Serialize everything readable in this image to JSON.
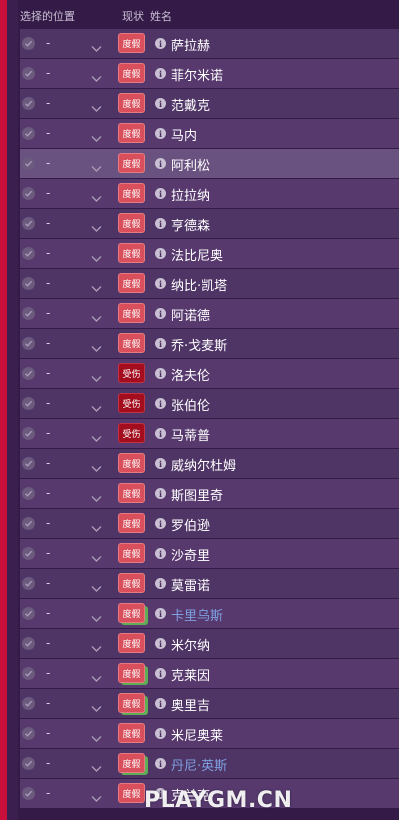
{
  "header": {
    "position_col": "选择的位置",
    "status_col": "现状",
    "name_col": "姓名"
  },
  "players": [
    {
      "position": "-",
      "status": "度假",
      "name": "萨拉赫"
    },
    {
      "position": "-",
      "status": "度假",
      "name": "菲尔米诺"
    },
    {
      "position": "-",
      "status": "度假",
      "name": "范戴克"
    },
    {
      "position": "-",
      "status": "度假",
      "name": "马内"
    },
    {
      "position": "-",
      "status": "度假",
      "name": "阿利松"
    },
    {
      "position": "-",
      "status": "度假",
      "name": "拉拉纳"
    },
    {
      "position": "-",
      "status": "度假",
      "name": "亨德森"
    },
    {
      "position": "-",
      "status": "度假",
      "name": "法比尼奥"
    },
    {
      "position": "-",
      "status": "度假",
      "name": "纳比·凯塔"
    },
    {
      "position": "-",
      "status": "度假",
      "name": "阿诺德"
    },
    {
      "position": "-",
      "status": "度假",
      "name": "乔·戈麦斯"
    },
    {
      "position": "-",
      "status": "受伤",
      "name": "洛夫伦"
    },
    {
      "position": "-",
      "status": "受伤",
      "name": "张伯伦"
    },
    {
      "position": "-",
      "status": "受伤",
      "name": "马蒂普"
    },
    {
      "position": "-",
      "status": "度假",
      "name": "威纳尔杜姆"
    },
    {
      "position": "-",
      "status": "度假",
      "name": "斯图里奇"
    },
    {
      "position": "-",
      "status": "度假",
      "name": "罗伯逊"
    },
    {
      "position": "-",
      "status": "度假",
      "name": "沙奇里"
    },
    {
      "position": "-",
      "status": "度假",
      "name": "莫雷诺"
    },
    {
      "position": "-",
      "status": "度假",
      "name": "卡里乌斯"
    },
    {
      "position": "-",
      "status": "度假",
      "name": "米尔纳"
    },
    {
      "position": "-",
      "status": "度假",
      "name": "克莱因"
    },
    {
      "position": "-",
      "status": "度假",
      "name": "奥里吉"
    },
    {
      "position": "-",
      "status": "度假",
      "name": "米尼奥莱"
    },
    {
      "position": "-",
      "status": "度假",
      "name": "丹尼·英斯"
    },
    {
      "position": "-",
      "status": "度假",
      "name": "克兰克"
    }
  ],
  "watermark": "PLAYGM.CN",
  "colors": {
    "accent_strip": "#c8103a",
    "holiday_badge": "#d94f5c",
    "injured_badge": "#a30d1e",
    "linked_name": "#7fa0e0"
  }
}
